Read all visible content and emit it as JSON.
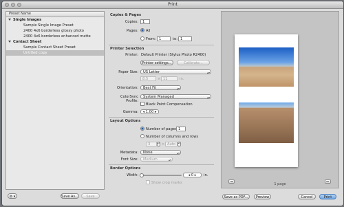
{
  "window": {
    "title": "Print"
  },
  "preset_panel": {
    "header": "Preset Name",
    "groups": [
      {
        "label": "Single Images",
        "items": [
          "Sample Single Image Preset",
          "2400 4x6 borderless glossy photo",
          "2400 4x6 borderless enhanced matte"
        ]
      },
      {
        "label": "Contact Sheet",
        "items": [
          "Sample Contact Sheet Preset",
          "Untitled copy"
        ]
      }
    ],
    "selected_item": "Untitled copy"
  },
  "bottom_left": {
    "gear": "⚙ ▾",
    "save_as": "Save As...",
    "save": "Save"
  },
  "copies_pages": {
    "heading": "Copies & Pages",
    "copies_label": "Copies:",
    "copies_value": "1",
    "pages_label": "Pages:",
    "all_label": "All",
    "from_label": "From:",
    "from_value": "1",
    "to_label": "to:",
    "to_value": "1"
  },
  "printer_selection": {
    "heading": "Printer Selection",
    "printer_label": "Printer:",
    "printer_value": "Default Printer (Stylus Photo R2400)",
    "printer_settings_btn": "Printer settings...",
    "calibrate_btn": "Calibrate...",
    "paper_size_label": "Paper Size:",
    "paper_size_value": "US Letter",
    "width_value": "8.5",
    "height_value": "11",
    "unit": "in.",
    "orientation_label": "Orientation:",
    "orientation_value": "Best Fit",
    "colorsync_label": "ColorSync Profile:",
    "colorsync_value": "System Managed",
    "bpc_label": "Black Point Compensation",
    "gamma_label": "Gamma:",
    "gamma_value": "1.00"
  },
  "layout_options": {
    "heading": "Layout Options",
    "num_pages_label": "Number of pages:",
    "num_pages_value": "1",
    "cols_rows_label": "Number of columns and rows",
    "cols_value": "3",
    "rows_value": "Auto",
    "metadata_label": "Metadata:",
    "metadata_value": "None",
    "font_size_label": "Font Size:",
    "font_size_value": "Medium"
  },
  "border_options": {
    "heading": "Border Options",
    "width_label": "Width:",
    "width_value": "0",
    "width_unit": "in.",
    "crop_marks_label": "Show crop marks"
  },
  "preview": {
    "page_count": "1 page",
    "prev_icon": "◂◂",
    "next_icon": "▸▸"
  },
  "bottom_right": {
    "save_pdf": "Save as PDF...",
    "preview": "Preview",
    "cancel": "Cancel",
    "print": "Print"
  }
}
